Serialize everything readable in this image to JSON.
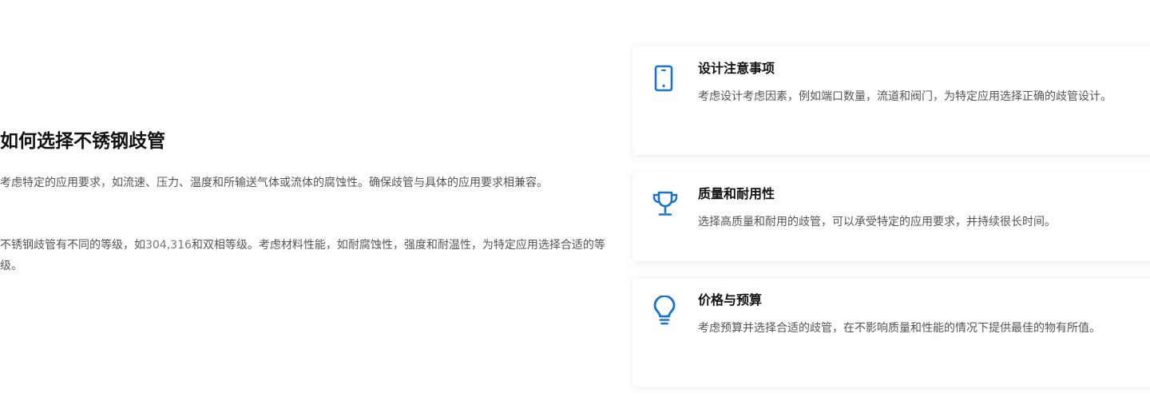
{
  "section": {
    "heading": "如何选择不锈钢歧管",
    "paragraph1": "考虑特定的应用要求，如流速、压力、温度和所输送气体或流体的腐蚀性。确保歧管与具体的应用要求相兼容。",
    "paragraph2_before": "不锈钢歧管有不同的等级，如",
    "paragraph2_grades": "304,316",
    "paragraph2_after": "和双相等级。考虑材料性能，如耐腐蚀性，强度和耐温性，为特定应用选择合适的等级。"
  },
  "cards": [
    {
      "icon": "mobile-phone-icon",
      "title": "设计注意事项",
      "description": "考虑设计考虑因素，例如端口数量，流道和阀门，为特定应用选择正确的歧管设计。"
    },
    {
      "icon": "trophy-icon",
      "title": "质量和耐用性",
      "description": "选择高质量和耐用的歧管，可以承受特定的应用要求，并持续很长时间。"
    },
    {
      "icon": "lightbulb-icon",
      "title": "价格与预算",
      "description": "考虑预算并选择合适的歧管，在不影响质量和性能的情况下提供最佳的物有所值。"
    }
  ],
  "colors": {
    "accent": "#1a73c9",
    "heading": "#111111",
    "body_text": "#555555"
  }
}
